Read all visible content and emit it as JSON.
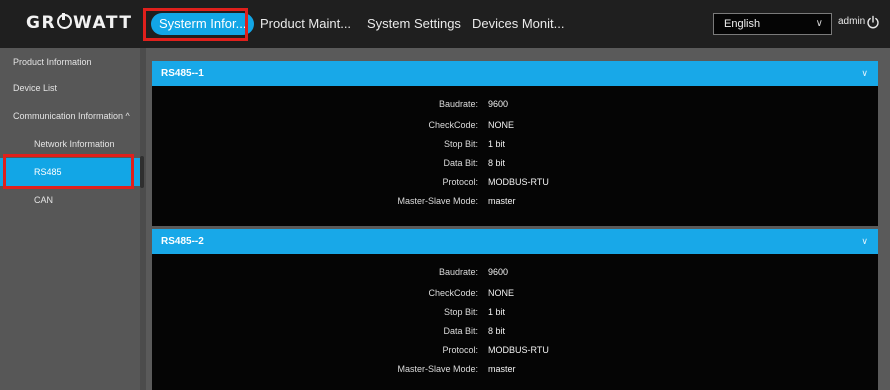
{
  "brand": {
    "logo_pre": "GR",
    "logo_post": "WATT"
  },
  "nav": {
    "tabs": [
      {
        "label": "Systerm Infor..."
      },
      {
        "label": "Product Maint..."
      },
      {
        "label": "System Settings"
      },
      {
        "label": "Devices Monit..."
      }
    ]
  },
  "header": {
    "language": "English",
    "user": "admin"
  },
  "sidebar": {
    "items": [
      {
        "label": "Product Information"
      },
      {
        "label": "Device List"
      },
      {
        "label": "Communication Information ^"
      },
      {
        "label": "Network Information"
      },
      {
        "label": "RS485"
      },
      {
        "label": "CAN"
      }
    ]
  },
  "panels": [
    {
      "title": "RS485--1",
      "rows": [
        {
          "label": "Baudrate:",
          "value": "9600"
        },
        {
          "label": "CheckCode:",
          "value": "NONE"
        },
        {
          "label": "Stop Bit:",
          "value": "1 bit"
        },
        {
          "label": "Data Bit:",
          "value": "8 bit"
        },
        {
          "label": "Protocol:",
          "value": "MODBUS-RTU"
        },
        {
          "label": "Master-Slave Mode:",
          "value": "master"
        }
      ]
    },
    {
      "title": "RS485--2",
      "rows": [
        {
          "label": "Baudrate:",
          "value": "9600"
        },
        {
          "label": "CheckCode:",
          "value": "NONE"
        },
        {
          "label": "Stop Bit:",
          "value": "1 bit"
        },
        {
          "label": "Data Bit:",
          "value": "8 bit"
        },
        {
          "label": "Protocol:",
          "value": "MODBUS-RTU"
        },
        {
          "label": "Master-Slave Mode:",
          "value": "master"
        }
      ]
    }
  ],
  "colors": {
    "accent": "#12a6e6",
    "highlight": "#e0201c",
    "topbar": "#1f1f1f",
    "sidebar": "#575757",
    "panel_body": "#050505"
  }
}
